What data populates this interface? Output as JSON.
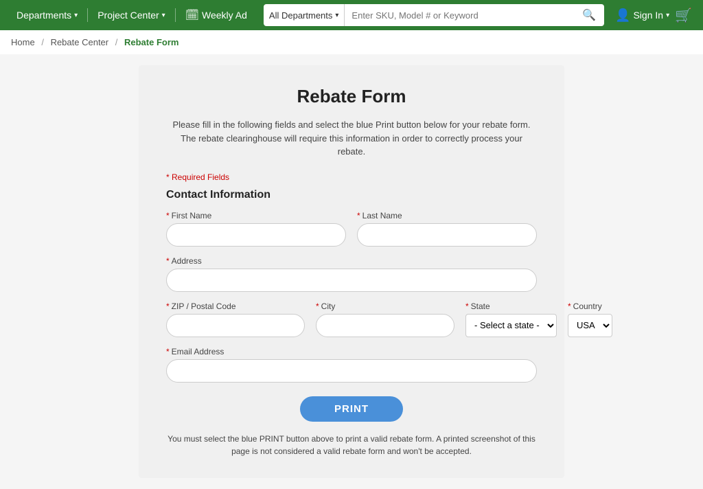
{
  "header": {
    "departments_label": "Departments",
    "project_center_label": "Project Center",
    "weekly_ad_label": "Weekly Ad",
    "search": {
      "dept_label": "All Departments",
      "placeholder": "Enter SKU, Model # or Keyword"
    },
    "sign_in_label": "Sign In"
  },
  "breadcrumb": {
    "home": "Home",
    "rebate_center": "Rebate Center",
    "current": "Rebate Form"
  },
  "form": {
    "title": "Rebate Form",
    "description": "Please fill in the following fields and select the blue Print button below for your rebate form. The rebate clearinghouse will require this information in order to correctly process your rebate.",
    "required_note": "* Required Fields",
    "section_title": "Contact Information",
    "fields": {
      "first_name_label": "First Name",
      "last_name_label": "Last Name",
      "address_label": "Address",
      "zip_label": "ZIP / Postal Code",
      "city_label": "City",
      "state_label": "State",
      "country_label": "Country",
      "email_label": "Email Address"
    },
    "state_placeholder": "- Select a state -",
    "country_default": "USA",
    "print_button": "PRINT",
    "print_note": "You must select the blue PRINT button above to print a valid rebate form. A printed screenshot of this page is not considered a valid rebate form and won't be accepted."
  }
}
